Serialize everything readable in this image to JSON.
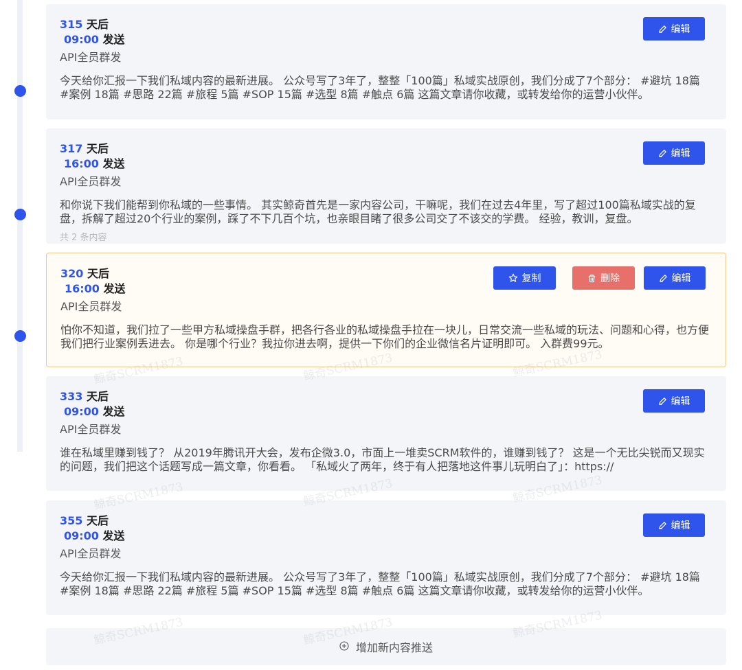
{
  "cards": [
    {
      "days": "315",
      "days_suffix": " 天后",
      "time": "09:00",
      "time_suffix": " 发送",
      "channel": "API全员群发",
      "content": "今天给你汇报一下我们私域内容的最新进展。 公众号写了3年了，整整「100篇」私域实战原创，我们分成了7个部分： #避坑 18篇 #案例 18篇 #思路 22篇 #旅程 5篇 #SOP 15篇 #选型 8篇 #触点 6篇 这篇文章请你收藏，或转发给你的运营小伙伴。"
    },
    {
      "days": "317",
      "days_suffix": " 天后",
      "time": "16:00",
      "time_suffix": " 发送",
      "channel": "API全员群发",
      "content": "和你说下我们能帮到你私域的一些事情。 其实鲸奇首先是一家内容公司，干嘛呢，我们在过去4年里，写了超过100篇私域实战的复盘，拆解了超过20个行业的案例，踩了不下几百个坑，也亲眼目睹了很多公司交了不该交的学费。 经验，教训，复盘。",
      "count_text": "共 2 条内容"
    },
    {
      "days": "320",
      "days_suffix": " 天后",
      "time": "16:00",
      "time_suffix": " 发送",
      "channel": "API全员群发",
      "content": "怕你不知道，我们拉了一些甲方私域操盘手群，把各行各业的私域操盘手拉在一块儿，日常交流一些私域的玩法、问题和心得，也方便我们把行业案例丢进去。 你是哪个行业？我拉你进去啊，提供一下你们的企业微信名片证明即可。 入群费99元。"
    },
    {
      "days": "333",
      "days_suffix": " 天后",
      "time": "09:00",
      "time_suffix": " 发送",
      "channel": "API全员群发",
      "content": "谁在私域里赚到钱了？ 从2019年腾讯开大会，发布企微3.0，市面上一堆卖SCRM软件的，谁赚到钱了？ 这是一个无比尖锐而又现实的问题，我们把这个话题写成一篇文章，你看看。 「私域火了两年，终于有人把落地这件事儿玩明白了」：https://"
    },
    {
      "days": "355",
      "days_suffix": " 天后",
      "time": "09:00",
      "time_suffix": " 发送",
      "channel": "API全员群发",
      "content": "今天给你汇报一下我们私域内容的最新进展。 公众号写了3年了，整整「100篇」私域实战原创，我们分成了7个部分： #避坑 18篇 #案例 18篇 #思路 22篇 #旅程 5篇 #SOP 15篇 #选型 8篇 #触点 6篇 这篇文章请你收藏，或转发给你的运营小伙伴。"
    }
  ],
  "buttons": {
    "edit": "编辑",
    "copy": "复制",
    "delete": "删除"
  },
  "add_label": "增加新内容推送",
  "watermark": "鲸奇SCRM1873",
  "colors": {
    "accent": "#2f54eb",
    "danger": "#e8706b",
    "active_border": "#f2c98a",
    "card_bg": "#f3f5f8"
  },
  "icons": {
    "edit": "pencil-icon",
    "copy": "star-icon",
    "delete": "trash-icon",
    "add": "plus-circle-icon"
  }
}
